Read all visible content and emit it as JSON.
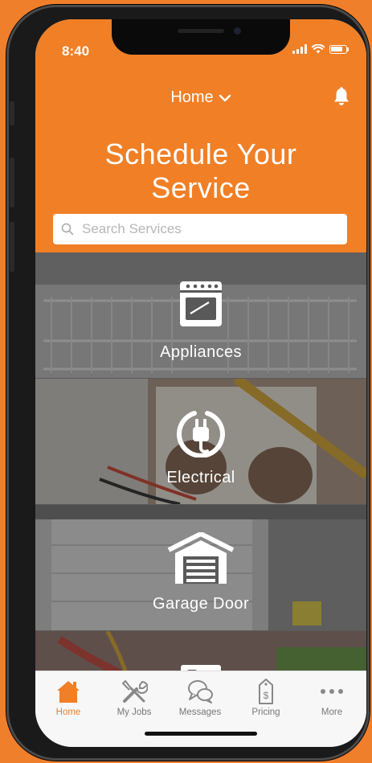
{
  "status_bar": {
    "time": "8:40"
  },
  "header": {
    "location": "Home",
    "title_line1": "Schedule Your",
    "title_line2": "Service"
  },
  "search": {
    "placeholder": "Search Services",
    "value": ""
  },
  "services": [
    {
      "label": "Appliances",
      "icon": "oven-icon"
    },
    {
      "label": "Electrical",
      "icon": "plug-icon"
    },
    {
      "label": "Garage Door",
      "icon": "garage-icon"
    }
  ],
  "tabs": [
    {
      "label": "Home",
      "icon": "home-icon",
      "active": true
    },
    {
      "label": "My Jobs",
      "icon": "tools-icon"
    },
    {
      "label": "Messages",
      "icon": "chat-icon"
    },
    {
      "label": "Pricing",
      "icon": "price-tag-icon"
    },
    {
      "label": "More",
      "icon": "more-icon"
    }
  ],
  "colors": {
    "accent": "#f07f26",
    "background": "#f07f2c"
  }
}
